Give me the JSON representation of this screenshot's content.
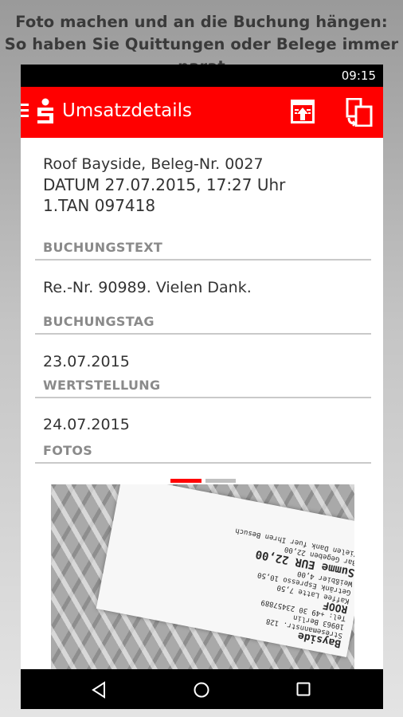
{
  "caption": {
    "line1": "Foto machen und an die Buchung hängen:",
    "line2": "So haben Sie Quittungen oder Belege immer parat"
  },
  "status_bar": {
    "time": "09:15"
  },
  "app_bar": {
    "title": "Umsatzdetails",
    "menu_icon": "hamburger-icon",
    "logo_icon": "sparkasse-s-logo",
    "actions": [
      "export-upload-icon",
      "copy-documents-icon"
    ],
    "color": "#ff0000"
  },
  "transaction": {
    "header_line1": "Roof Bayside, Beleg-Nr. 0027",
    "header_line2": "DATUM 27.07.2015, 17:27 Uhr",
    "header_line3": "1.TAN 097418"
  },
  "sections": [
    {
      "label": "BUCHUNGSTEXT",
      "value": "Re.-Nr. 90989. Vielen Dank."
    },
    {
      "label": "BUCHUNGSTAG",
      "value": "23.07.2015"
    },
    {
      "label": "WERTSTELLUNG",
      "value": "24.07.2015"
    },
    {
      "label": "FOTOS",
      "value": ""
    }
  ],
  "photos": {
    "page_count": 2,
    "active_index": 0,
    "receipt": {
      "brand": "Bayside",
      "name": "ROOF",
      "total_label": "Summe",
      "currency": "EUR",
      "total": "22,00",
      "lines": [
        "Stresemannstr. 128",
        "10963 Berlin",
        "Tel: +49 30 23457889",
        "Kaffee Latte  7,50",
        "Getränk Espresso  10,50",
        "Weißbier  4,00",
        "Bar Gegeben  22,00",
        "Vielen Dank fuer Ihren Besuch"
      ]
    }
  },
  "nav_bar": {
    "back_icon": "back-triangle-icon",
    "home_icon": "home-circle-icon",
    "recent_icon": "recent-apps-square-icon"
  }
}
